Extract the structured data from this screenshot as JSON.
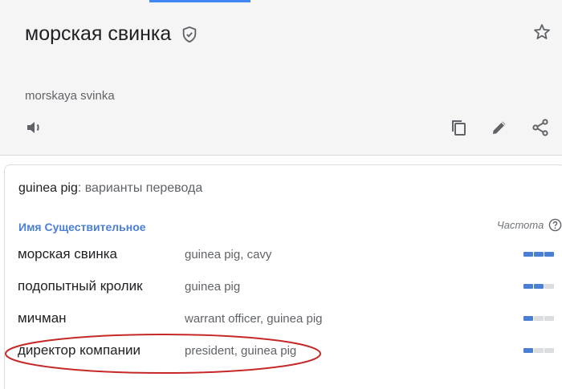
{
  "translation": {
    "text": "морская свинка",
    "transliteration": "morskaya svinka"
  },
  "card": {
    "title_term": "guinea pig",
    "title_suffix": ": варианты перевода",
    "part_of_speech": "Имя Существительное",
    "frequency_label": "Частота"
  },
  "rows": [
    {
      "word": "морская свинка",
      "meanings": "guinea pig, cavy",
      "frequency": 3
    },
    {
      "word": "подопытный кролик",
      "meanings": "guinea pig",
      "frequency": 2
    },
    {
      "word": "мичман",
      "meanings": "warrant officer, guinea pig",
      "frequency": 1
    },
    {
      "word": "директор компании",
      "meanings": "president, guinea pig",
      "frequency": 1
    }
  ],
  "icons": {
    "verified": "verified-shield-icon",
    "star": "star-icon",
    "listen": "speaker-icon",
    "copy": "copy-icon",
    "edit": "edit-pencil-icon",
    "share": "share-icon",
    "help": "help-icon"
  },
  "colors": {
    "accent": "#4285f4",
    "pos_label": "#4a7fd4",
    "highlight_ellipse": "#c62828"
  }
}
